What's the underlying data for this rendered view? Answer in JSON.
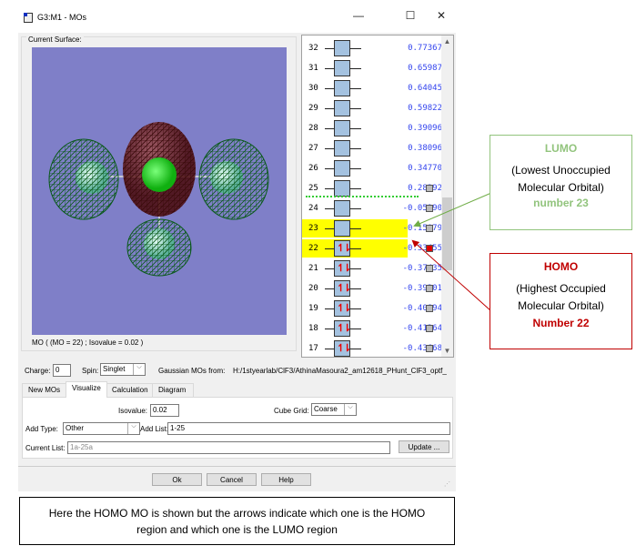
{
  "window": {
    "title": "G3:M1 - MOs",
    "minimize": "—",
    "maximize": "☐",
    "close": "✕"
  },
  "surface": {
    "label": "Current Surface:",
    "caption": "MO ( (MO = 22) ; Isovalue = 0.02 )",
    "background": "#7f7fc8"
  },
  "mo_list": {
    "rows": [
      {
        "n": "32",
        "energy": "0.77367",
        "occ": false,
        "hl": false,
        "chk": ""
      },
      {
        "n": "31",
        "energy": "0.65987",
        "occ": false,
        "hl": false,
        "chk": ""
      },
      {
        "n": "30",
        "energy": "0.64045",
        "occ": false,
        "hl": false,
        "chk": ""
      },
      {
        "n": "29",
        "energy": "0.59822",
        "occ": false,
        "hl": false,
        "chk": ""
      },
      {
        "n": "28",
        "energy": "0.39096",
        "occ": false,
        "hl": false,
        "chk": ""
      },
      {
        "n": "27",
        "energy": "0.38096",
        "occ": false,
        "hl": false,
        "chk": ""
      },
      {
        "n": "26",
        "energy": "0.34770",
        "occ": false,
        "hl": false,
        "chk": ""
      },
      {
        "n": "25",
        "energy": "0.28392",
        "occ": false,
        "hl": false,
        "chk": "gray"
      },
      {
        "n": "24",
        "energy": "-0.05190",
        "occ": false,
        "hl": false,
        "chk": "gray"
      },
      {
        "n": "23",
        "energy": "-0.15079",
        "occ": false,
        "hl": true,
        "chk": "gray"
      },
      {
        "n": "22",
        "energy": "-0.33455",
        "occ": true,
        "hl": true,
        "chk": "red"
      },
      {
        "n": "21",
        "energy": "-0.37435",
        "occ": true,
        "hl": false,
        "chk": "gray"
      },
      {
        "n": "20",
        "energy": "-0.39201",
        "occ": true,
        "hl": false,
        "chk": "gray"
      },
      {
        "n": "19",
        "energy": "-0.40894",
        "occ": true,
        "hl": false,
        "chk": "gray"
      },
      {
        "n": "18",
        "energy": "-0.41264",
        "occ": true,
        "hl": false,
        "chk": "gray"
      },
      {
        "n": "17",
        "energy": "-0.43668",
        "occ": true,
        "hl": false,
        "chk": "gray"
      }
    ],
    "spin_up": "↿",
    "spin_down": "⇂",
    "highlight": "#ffff00"
  },
  "controls": {
    "charge_label": "Charge:",
    "charge": "0",
    "spin_label": "Spin:",
    "spin": "Singlet",
    "source_label": "Gaussian MOs from:",
    "source": "H:/1styearlab/ClF3/AthinaMasoura2_am12618_PHunt_ClF3_optf_"
  },
  "tabs": [
    "New MOs",
    "Visualize",
    "Calculation",
    "Diagram"
  ],
  "visualize": {
    "isovalue_label": "Isovalue:",
    "isovalue": "0.02",
    "cube_grid_label": "Cube Grid:",
    "cube_grid": "Coarse",
    "add_type_label": "Add Type:",
    "add_type": "Other",
    "add_list_label": "Add List:",
    "add_list": "1-25",
    "current_list_label": "Current List:",
    "current_list": "1a-25a",
    "update": "Update ..."
  },
  "footer": {
    "ok": "Ok",
    "cancel": "Cancel",
    "help": "Help"
  },
  "lumo_note": {
    "title": "LUMO",
    "desc": "(Lowest Unoccupied Molecular Orbital)",
    "number": "number 23",
    "color": "#92c47d"
  },
  "homo_note": {
    "title": "HOMO",
    "desc": "(Highest Occupied Molecular Orbital)",
    "number": "Number 22",
    "color": "#c00000"
  },
  "bottom_note": "Here the HOMO MO is shown but the arrows indicate which one is the HOMO region and which one is the LUMO region"
}
